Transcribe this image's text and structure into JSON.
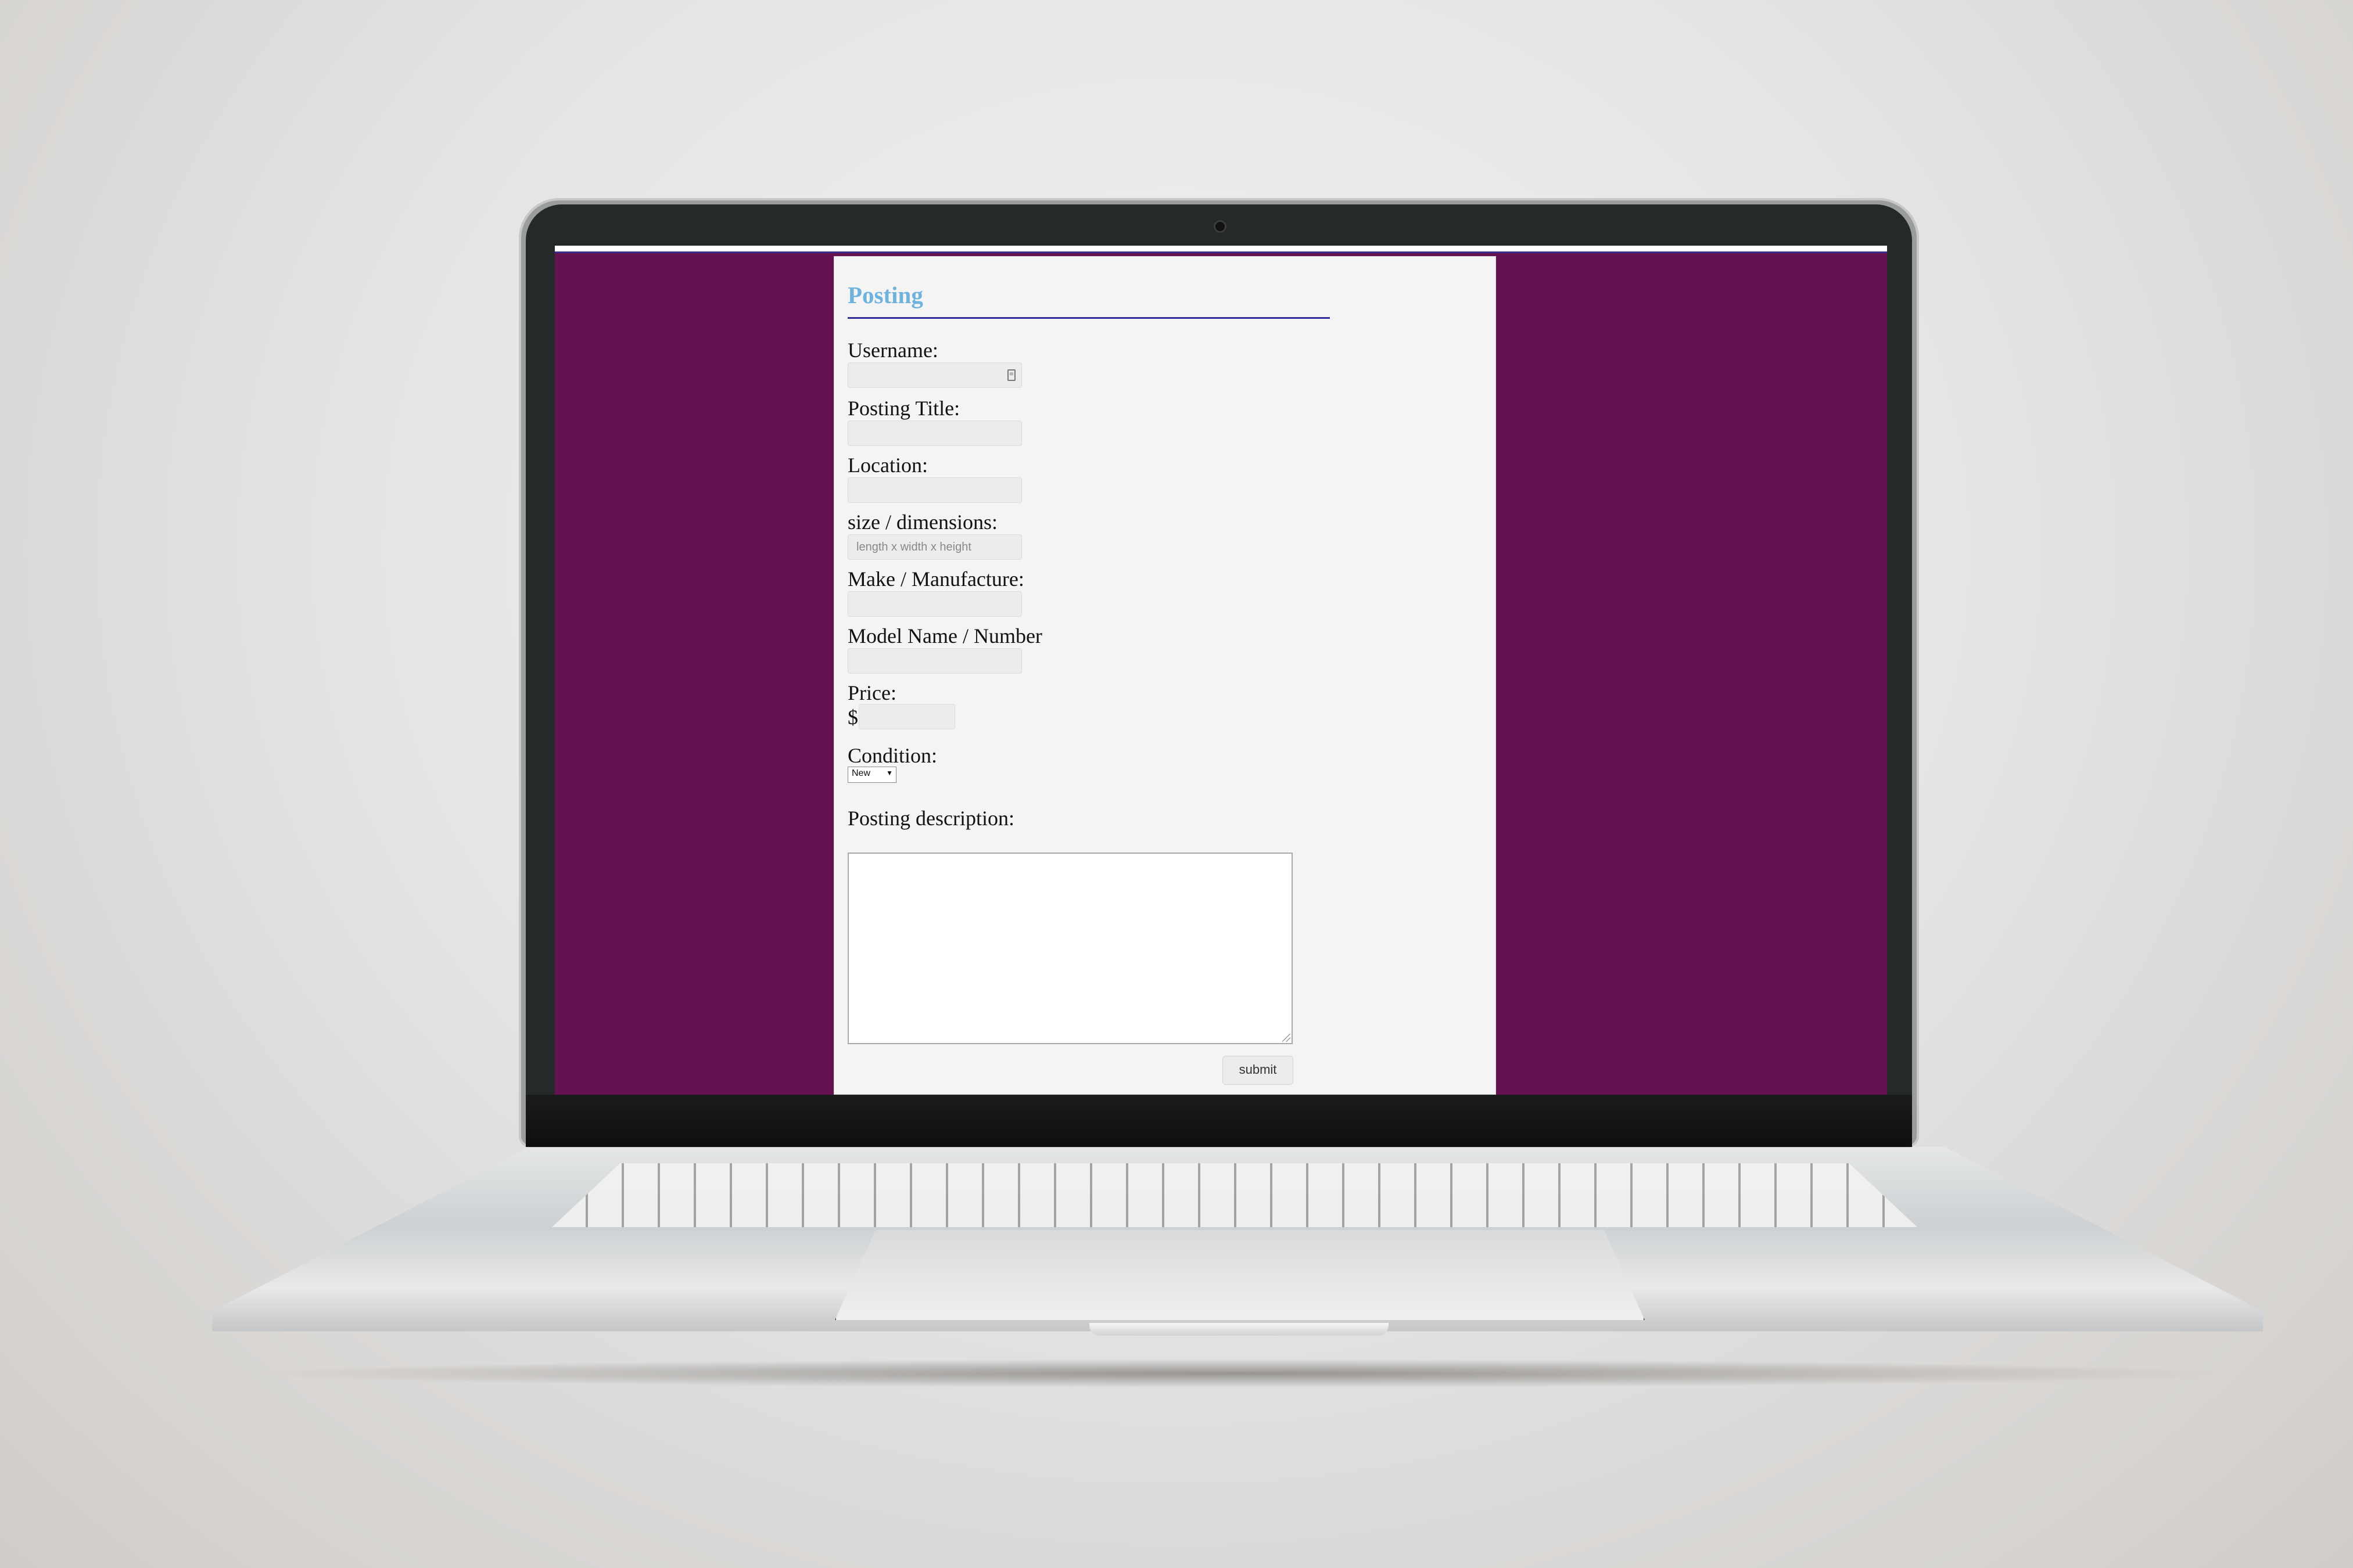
{
  "form": {
    "title": "Posting",
    "fields": {
      "username": {
        "label": "Username:",
        "value": "",
        "placeholder": ""
      },
      "posting_title": {
        "label": "Posting Title:",
        "value": "",
        "placeholder": ""
      },
      "location": {
        "label": "Location:",
        "value": "",
        "placeholder": ""
      },
      "size": {
        "label": "size / dimensions:",
        "value": "",
        "placeholder": "length x width x height"
      },
      "make": {
        "label": "Make / Manufacture:",
        "value": "",
        "placeholder": ""
      },
      "model": {
        "label": "Model Name / Number",
        "value": "",
        "placeholder": ""
      },
      "price": {
        "label": "Price:",
        "currency": "$",
        "value": ""
      },
      "condition": {
        "label": "Condition:",
        "selected": "New",
        "arrow": "▼"
      },
      "description": {
        "label": "Posting description:",
        "value": ""
      }
    },
    "submit_label": "submit"
  },
  "icons": {
    "username_autofill": "contact-card-icon"
  },
  "colors": {
    "page_background": "#641350",
    "title": "#6fb2dc",
    "title_rule": "#2f2d9b",
    "panel": "#f4f4f4"
  }
}
